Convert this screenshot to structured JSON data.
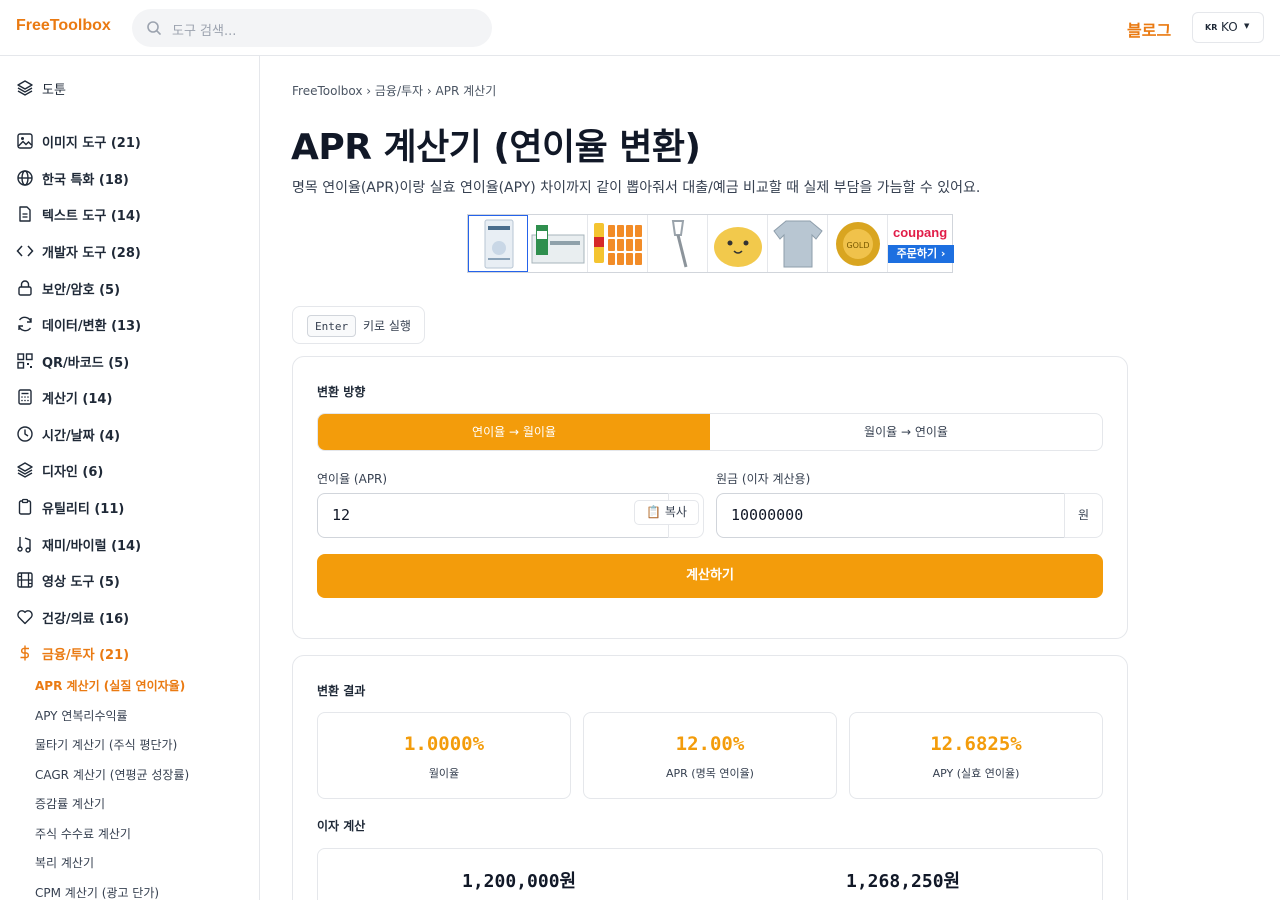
{
  "header": {
    "logo": "FreeToolbox",
    "search_placeholder": "도구 검색...",
    "blog": "블로그",
    "lang_flag": "KR",
    "lang_code": "KO"
  },
  "sidebar": {
    "top": "도툰",
    "categories": [
      {
        "label": "이미지 도구 (21)",
        "icon": "image-icon"
      },
      {
        "label": "한국 특화 (18)",
        "icon": "globe-icon"
      },
      {
        "label": "텍스트 도구 (14)",
        "icon": "document-icon"
      },
      {
        "label": "개발자 도구 (28)",
        "icon": "code-icon"
      },
      {
        "label": "보안/암호 (5)",
        "icon": "lock-icon"
      },
      {
        "label": "데이터/변환 (13)",
        "icon": "refresh-icon"
      },
      {
        "label": "QR/바코드 (5)",
        "icon": "qr-icon"
      },
      {
        "label": "계산기 (14)",
        "icon": "calculator-icon"
      },
      {
        "label": "시간/날짜 (4)",
        "icon": "clock-icon"
      },
      {
        "label": "디자인 (6)",
        "icon": "layers-icon"
      },
      {
        "label": "유틸리티 (11)",
        "icon": "clipboard-icon"
      },
      {
        "label": "재미/바이럴 (14)",
        "icon": "music-icon"
      },
      {
        "label": "영상 도구 (5)",
        "icon": "film-icon"
      },
      {
        "label": "건강/의료 (16)",
        "icon": "heart-icon"
      },
      {
        "label": "금융/투자 (21)",
        "icon": "dollar-icon"
      }
    ],
    "sub_items": [
      "APR 계산기 (실질 연이자율)",
      "APY 연복리수익률",
      "물타기 계산기 (주식 평단가)",
      "CAGR 계산기 (연평균 성장률)",
      "증감률 계산기",
      "주식 수수료 계산기",
      "복리 계산기",
      "CPM 계산기 (광고 단가)"
    ]
  },
  "main": {
    "breadcrumb": "FreeToolbox › 금융/투자 › APR 계산기",
    "title": "APR 계산기 (연이율 변환)",
    "description": "명목 연이율(APR)이랑 실효 연이율(APY) 차이까지 같이 뽑아줘서 대출/예금 비교할 때 실제 부담을 가늠할 수 있어요.",
    "ad_brand": "coupang",
    "ad_button": "주문하기 ›",
    "enter_key": "Enter",
    "enter_hint": "키로 실행"
  },
  "form": {
    "direction_label": "변환 방향",
    "option_a": "연이율 → 월이율",
    "option_b": "월이율 → 연이율",
    "apr_label": "연이율 (APR)",
    "apr_value": "12",
    "copy": "📋 복사",
    "principal_label": "원금 (이자 계산용)",
    "principal_value": "10000000",
    "unit": "원",
    "submit": "계산하기"
  },
  "results": {
    "label": "변환 결과",
    "cards": [
      {
        "value": "1.0000%",
        "caption": "월이율"
      },
      {
        "value": "12.00%",
        "caption": "APR (명목 연이율)"
      },
      {
        "value": "12.6825%",
        "caption": "APY (실효 연이율)"
      }
    ],
    "interest_label": "이자 계산",
    "interest_simple": "1,200,000원",
    "interest_compound": "1,268,250원"
  },
  "colors": {
    "accent": "#f39c0b",
    "brand": "#ea7a12"
  }
}
